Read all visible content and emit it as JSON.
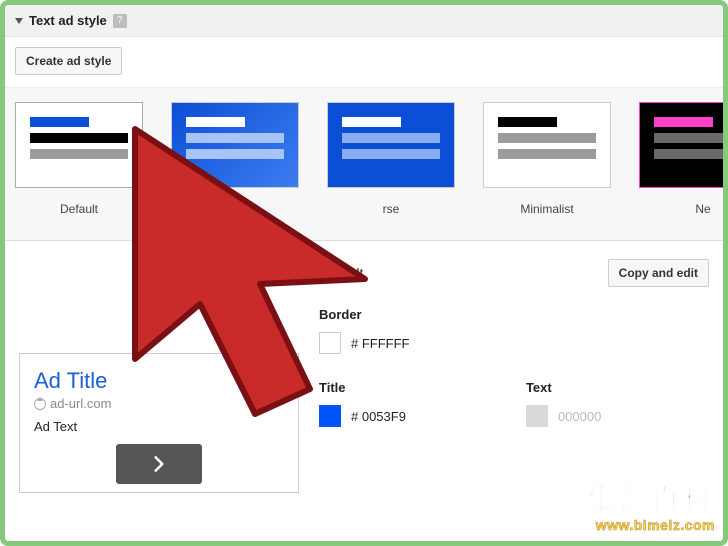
{
  "header": {
    "title": "Text ad style"
  },
  "toolbar": {
    "create_btn": "Create ad style"
  },
  "styles": [
    {
      "label": "Default",
      "bg": "#ffffff",
      "bar1": "#0b4fd6",
      "bar2": "#000000",
      "bar3": "#9b9b9b"
    },
    {
      "label": "",
      "bg": "#0b4fd6",
      "bar1": "#ffffff",
      "bar2": "#88aef0",
      "bar3": "#88aef0"
    },
    {
      "label": "rse",
      "bg": "#0b4fd6",
      "bar1": "#ffffff",
      "bar2": "#88aef0",
      "bar3": "#88aef0"
    },
    {
      "label": "Minimalist",
      "bg": "#ffffff",
      "bar1": "#000000",
      "bar2": "#9b9b9b",
      "bar3": "#9b9b9b"
    },
    {
      "label": "Ne",
      "bg": "#000000",
      "bar1": "#ff3ec9",
      "bar2": "#6a6a6a",
      "bar3": "#6a6a6a",
      "border": "#ff3ec9"
    }
  ],
  "preview": {
    "title": "Ad Title",
    "url": "ad-url.com",
    "text": "Ad Text"
  },
  "settings": {
    "name": "Default",
    "copy_btn": "Copy and edit",
    "border": {
      "label": "Border",
      "hex": "# FFFFFF"
    },
    "title": {
      "label": "Title",
      "hex": "# 0053F9"
    },
    "text": {
      "label": "Text",
      "hex": "000000"
    }
  },
  "watermark": {
    "cn": "生活百科",
    "url": "www.bimeiz.com"
  }
}
